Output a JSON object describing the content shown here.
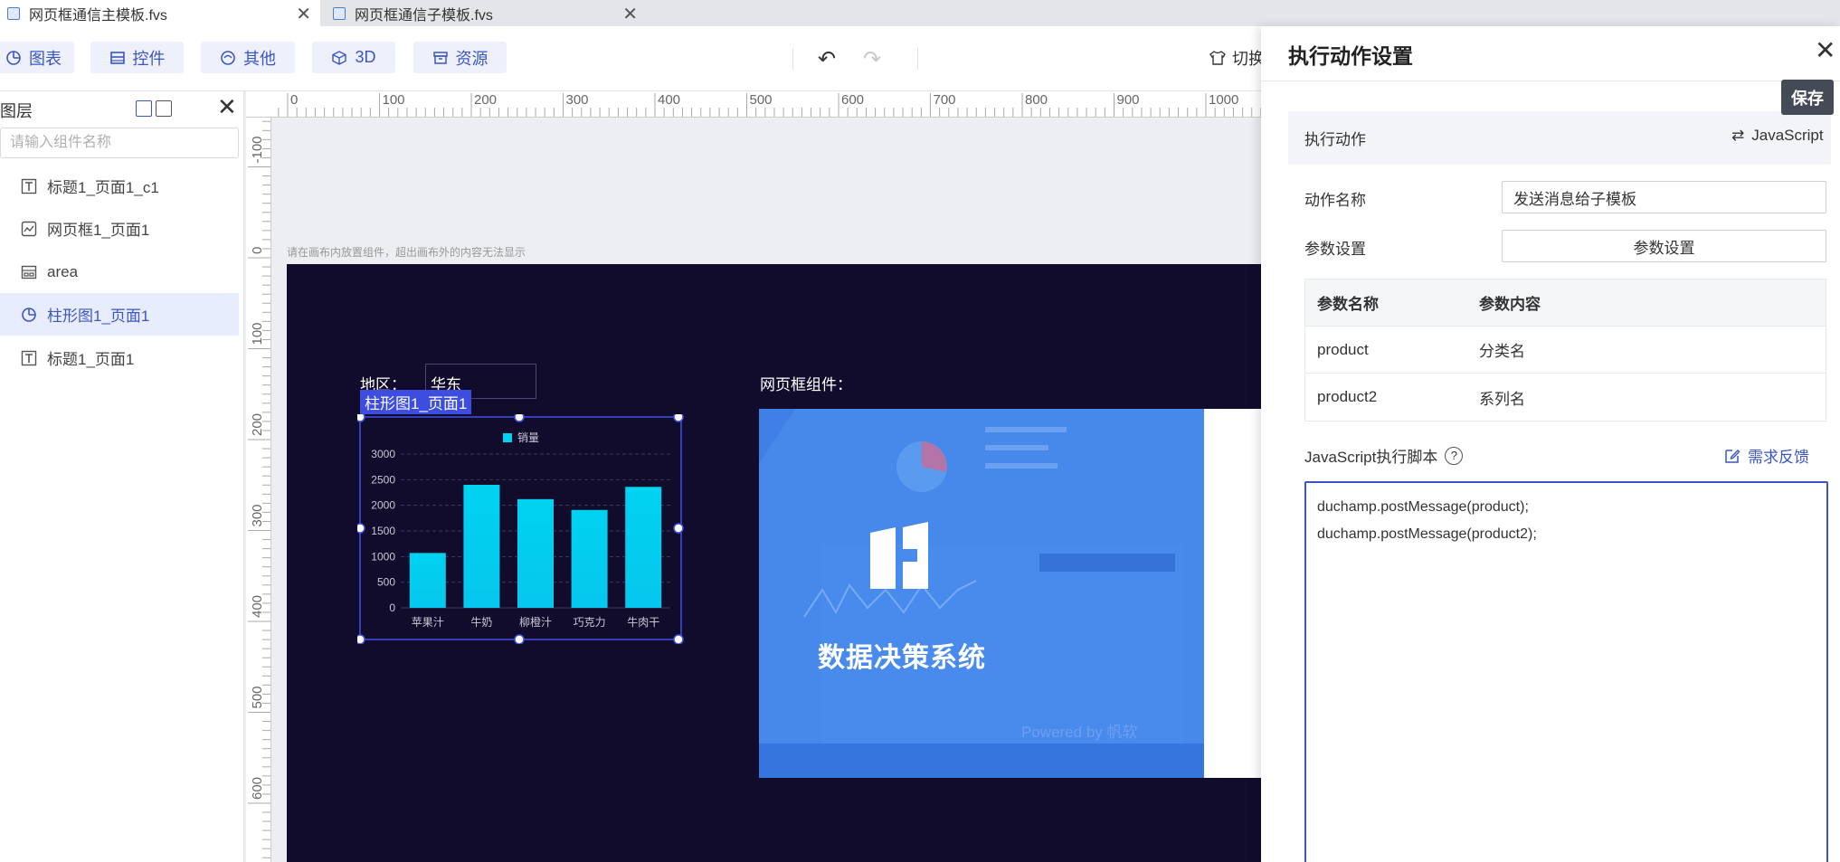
{
  "tabs": [
    {
      "label": "网页框通信主模板.fvs"
    },
    {
      "label": "网页框通信子模板.fvs"
    }
  ],
  "toolbar": {
    "buttons": [
      {
        "label": "图表",
        "icon": "chart-icon"
      },
      {
        "label": "控件",
        "icon": "widget-icon"
      },
      {
        "label": "其他",
        "icon": "other-icon"
      },
      {
        "label": "3D",
        "icon": "cube-icon"
      },
      {
        "label": "资源",
        "icon": "resource-icon"
      }
    ],
    "switch_label": "切换"
  },
  "layers": {
    "title": "图层",
    "search_placeholder": "请输入组件名称",
    "items": [
      {
        "label": "标题1_页面1_c1",
        "icon": "text-icon"
      },
      {
        "label": "网页框1_页面1",
        "icon": "webframe-icon"
      },
      {
        "label": "area",
        "icon": "area-icon"
      },
      {
        "label": "柱形图1_页面1",
        "icon": "chart-icon",
        "selected": true
      },
      {
        "label": "标题1_页面1",
        "icon": "text-icon"
      }
    ]
  },
  "rulers": {
    "top": [
      "0",
      "100",
      "200",
      "300",
      "400",
      "500",
      "600",
      "700",
      "800",
      "900",
      "1000"
    ],
    "left": [
      "-100",
      "0",
      "100",
      "200",
      "300",
      "400",
      "500",
      "600"
    ]
  },
  "canvas": {
    "hint": "请在画布内放置组件，超出画布外的内容无法显示",
    "region_label": "地区：",
    "region_value": "华东",
    "iframe_label": "网页框组件：",
    "selected_tag": "柱形图1_页面1",
    "iframe_title": "数据决策系统",
    "iframe_powered": "Powered by 帆软"
  },
  "chart_data": {
    "type": "bar",
    "categories": [
      "苹果汁",
      "牛奶",
      "柳橙汁",
      "巧克力",
      "牛肉干"
    ],
    "series": [
      {
        "name": "销量",
        "values": [
          1070,
          2400,
          2120,
          1910,
          2360
        ]
      }
    ],
    "yticks": [
      "0",
      "500",
      "1000",
      "1500",
      "2000",
      "2500",
      "3000"
    ],
    "ylim": [
      0,
      3000
    ],
    "color": "#00d2f0",
    "legend": "top-center"
  },
  "action_panel": {
    "title": "执行动作设置",
    "save_label": "保存",
    "section_label": "执行动作",
    "js_label": "JavaScript",
    "action_name_label": "动作名称",
    "action_name_value": "发送消息给子模板",
    "params_label": "参数设置",
    "params_button": "参数设置",
    "table_headers": [
      "参数名称",
      "参数内容"
    ],
    "table_rows": [
      [
        "product",
        "分类名"
      ],
      [
        "product2",
        "系列名"
      ]
    ],
    "script_label": "JavaScript执行脚本",
    "feedback_label": "需求反馈",
    "script_lines": [
      "duchamp.postMessage(product);",
      "duchamp.postMessage(product2);"
    ]
  }
}
